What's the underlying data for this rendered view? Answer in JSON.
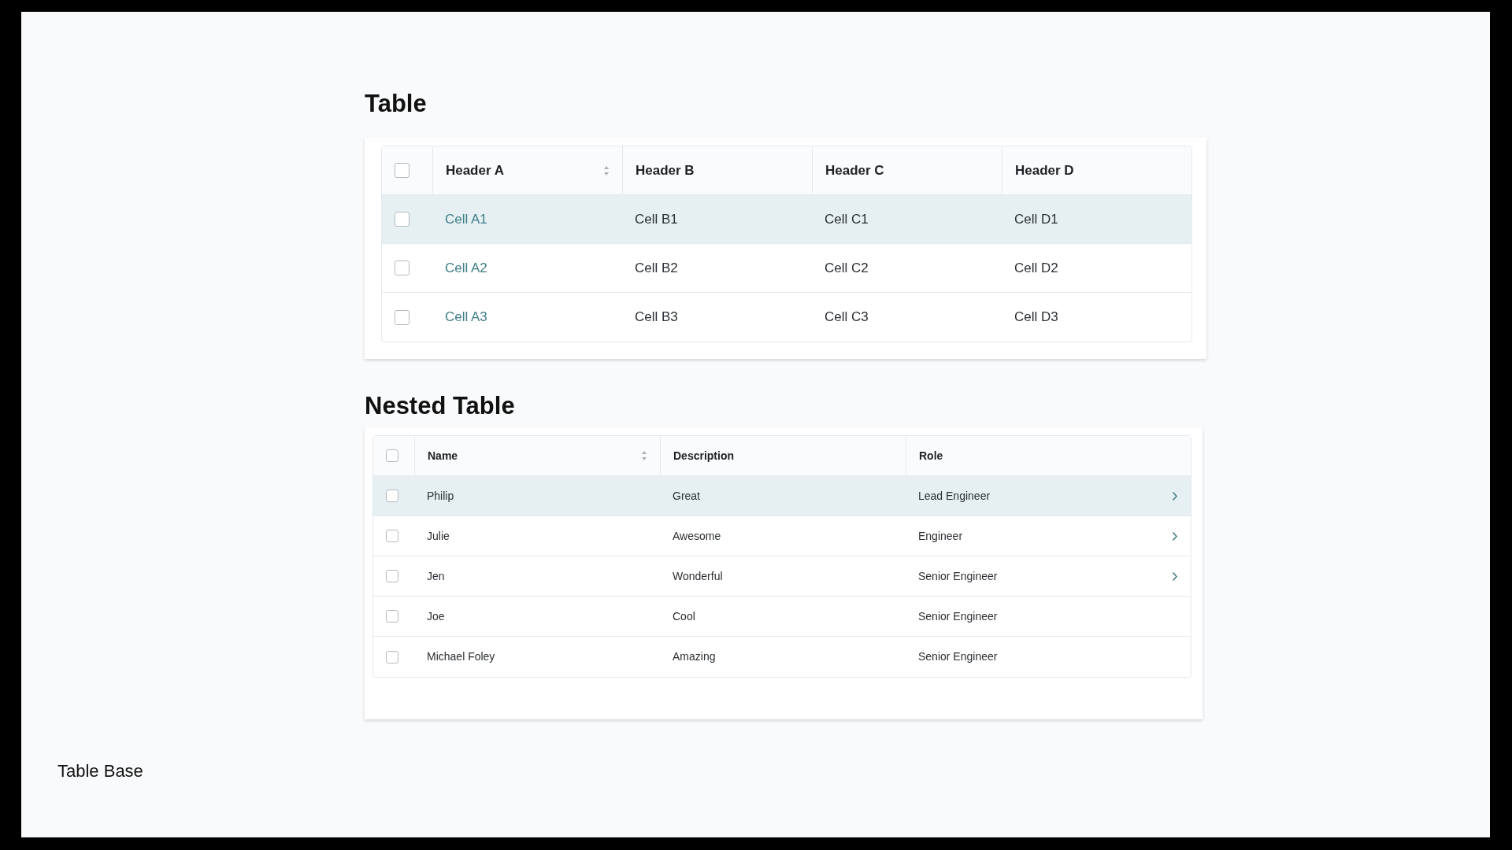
{
  "sections": [
    {
      "title": "Table",
      "kind": "basic",
      "columns": [
        {
          "label": "Header A",
          "sortable": true
        },
        {
          "label": "Header B",
          "sortable": false
        },
        {
          "label": "Header C",
          "sortable": false
        },
        {
          "label": "Header D",
          "sortable": false
        }
      ],
      "header_checked": false,
      "rows": [
        {
          "cells": [
            "Cell A1",
            "Cell B1",
            "Cell C1",
            "Cell D1"
          ],
          "checked": false,
          "hovered": true,
          "expandable": false
        },
        {
          "cells": [
            "Cell A2",
            "Cell B2",
            "Cell C2",
            "Cell D2"
          ],
          "checked": false,
          "hovered": false,
          "expandable": false
        },
        {
          "cells": [
            "Cell A3",
            "Cell B3",
            "Cell C3",
            "Cell D3"
          ],
          "checked": false,
          "hovered": false,
          "expandable": false
        }
      ]
    },
    {
      "title": "Nested Table",
      "kind": "nested",
      "columns": [
        {
          "label": "Name",
          "sortable": true
        },
        {
          "label": "Description",
          "sortable": false
        },
        {
          "label": "Role",
          "sortable": false
        }
      ],
      "header_checked": false,
      "rows": [
        {
          "cells": [
            "Philip",
            "Great",
            "Lead Engineer"
          ],
          "checked": false,
          "hovered": true,
          "expandable": true
        },
        {
          "cells": [
            "Julie",
            "Awesome",
            "Engineer"
          ],
          "checked": false,
          "hovered": false,
          "expandable": true
        },
        {
          "cells": [
            "Jen",
            "Wonderful",
            "Senior Engineer"
          ],
          "checked": false,
          "hovered": false,
          "expandable": true
        },
        {
          "cells": [
            "Joe",
            "Cool",
            "Senior Engineer"
          ],
          "checked": false,
          "hovered": false,
          "expandable": false
        },
        {
          "cells": [
            "Michael Foley",
            "Amazing",
            "Senior Engineer"
          ],
          "checked": false,
          "hovered": false,
          "expandable": false
        }
      ]
    }
  ],
  "caption": "Table Base"
}
